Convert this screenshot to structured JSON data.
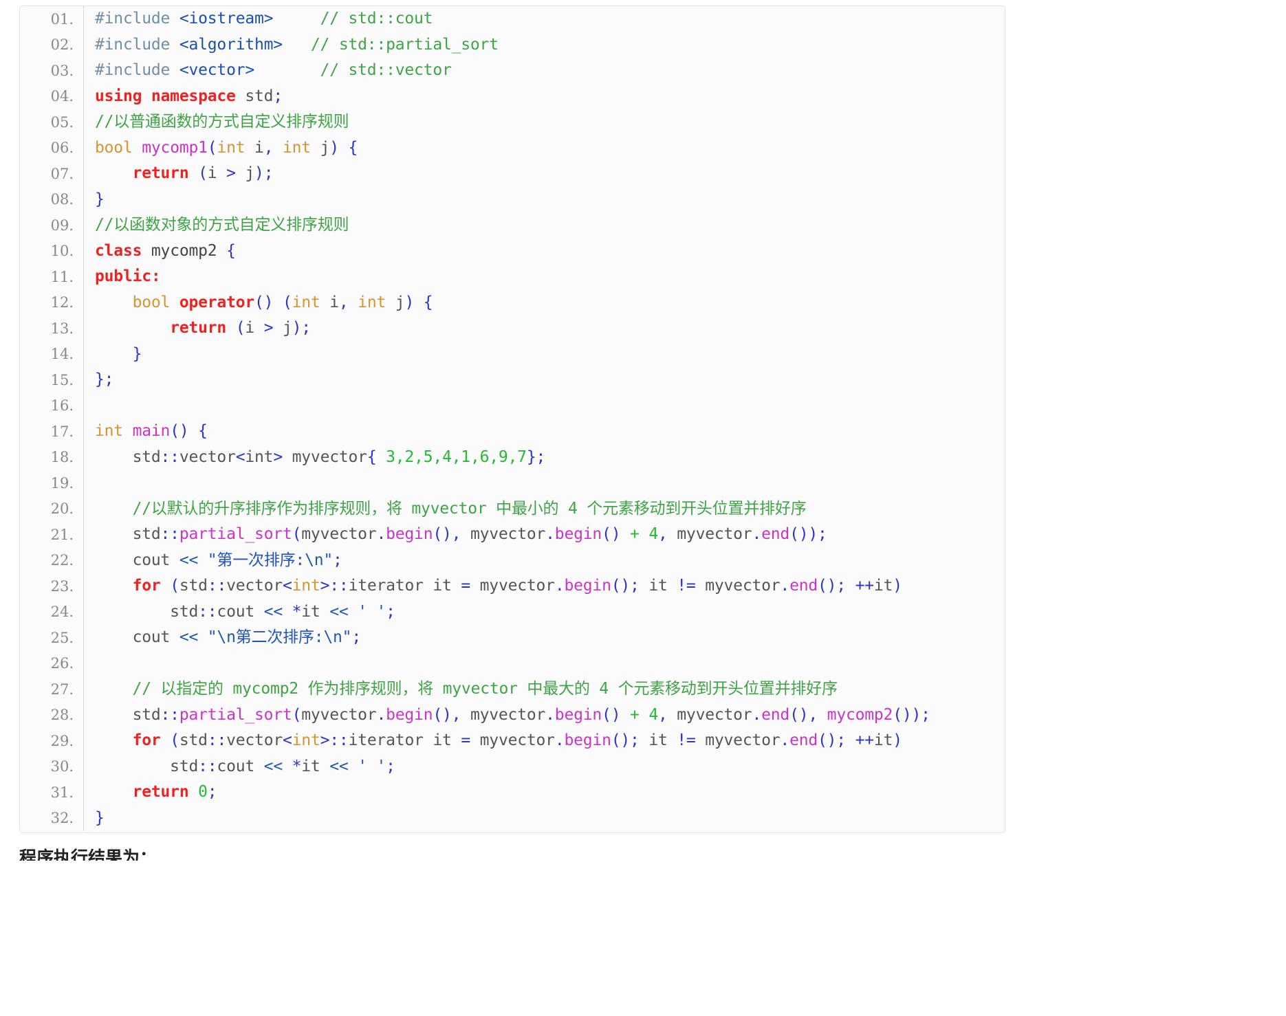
{
  "code_block": {
    "language": "cpp",
    "line_number_suffix": ".",
    "total_lines": 32,
    "colors": {
      "background": "#fbfbfb",
      "border": "#e3e3e3",
      "gutter_text": "#888888",
      "comment": "#3ea445",
      "keyword": "#ee2222",
      "type": "#d69532",
      "function": "#cc33cc",
      "punctuation": "#2b33cc",
      "number": "#22bb33",
      "string": "#2255bb",
      "preprocessor": "#6f8ea8",
      "header_name": "#1a4fb4",
      "plain": "#555555"
    },
    "lines": [
      {
        "num": "01.",
        "tokens": [
          {
            "t": "#include ",
            "c": "t-pre"
          },
          {
            "t": "<iostream>",
            "c": "t-header"
          },
          {
            "t": "     ",
            "c": "t-plain"
          },
          {
            "t": "// std::cout",
            "c": "t-comment"
          }
        ]
      },
      {
        "num": "02.",
        "tokens": [
          {
            "t": "#include ",
            "c": "t-pre"
          },
          {
            "t": "<algorithm>",
            "c": "t-header"
          },
          {
            "t": "   ",
            "c": "t-plain"
          },
          {
            "t": "// std::partial_sort",
            "c": "t-comment"
          }
        ]
      },
      {
        "num": "03.",
        "tokens": [
          {
            "t": "#include ",
            "c": "t-pre"
          },
          {
            "t": "<vector>",
            "c": "t-header"
          },
          {
            "t": "       ",
            "c": "t-plain"
          },
          {
            "t": "// std::vector",
            "c": "t-comment"
          }
        ]
      },
      {
        "num": "04.",
        "tokens": [
          {
            "t": "using namespace",
            "c": "t-kw"
          },
          {
            "t": " std",
            "c": "t-plain"
          },
          {
            "t": ";",
            "c": "t-punc"
          }
        ]
      },
      {
        "num": "05.",
        "tokens": [
          {
            "t": "//以普通函数的方式自定义排序规则",
            "c": "t-comment"
          }
        ]
      },
      {
        "num": "06.",
        "tokens": [
          {
            "t": "bool",
            "c": "t-type"
          },
          {
            "t": " ",
            "c": "t-plain"
          },
          {
            "t": "mycomp1",
            "c": "t-fn"
          },
          {
            "t": "(",
            "c": "t-punc"
          },
          {
            "t": "int",
            "c": "t-type"
          },
          {
            "t": " i",
            "c": "t-plain"
          },
          {
            "t": ",",
            "c": "t-punc"
          },
          {
            "t": " ",
            "c": "t-plain"
          },
          {
            "t": "int",
            "c": "t-type"
          },
          {
            "t": " j",
            "c": "t-plain"
          },
          {
            "t": ") {",
            "c": "t-punc"
          }
        ]
      },
      {
        "num": "07.",
        "tokens": [
          {
            "t": "    ",
            "c": "t-plain"
          },
          {
            "t": "return",
            "c": "t-kw"
          },
          {
            "t": " ",
            "c": "t-plain"
          },
          {
            "t": "(",
            "c": "t-punc"
          },
          {
            "t": "i ",
            "c": "t-plain"
          },
          {
            "t": ">",
            "c": "t-punc"
          },
          {
            "t": " j",
            "c": "t-plain"
          },
          {
            "t": ");",
            "c": "t-punc"
          }
        ]
      },
      {
        "num": "08.",
        "tokens": [
          {
            "t": "}",
            "c": "t-punc"
          }
        ]
      },
      {
        "num": "09.",
        "tokens": [
          {
            "t": "//以函数对象的方式自定义排序规则",
            "c": "t-comment"
          }
        ]
      },
      {
        "num": "10.",
        "tokens": [
          {
            "t": "class",
            "c": "t-kw"
          },
          {
            "t": " mycomp2 ",
            "c": "t-ident"
          },
          {
            "t": "{",
            "c": "t-punc"
          }
        ]
      },
      {
        "num": "11.",
        "tokens": [
          {
            "t": "public:",
            "c": "t-kw"
          }
        ]
      },
      {
        "num": "12.",
        "tokens": [
          {
            "t": "    ",
            "c": "t-plain"
          },
          {
            "t": "bool",
            "c": "t-type"
          },
          {
            "t": " ",
            "c": "t-plain"
          },
          {
            "t": "operator",
            "c": "t-kw"
          },
          {
            "t": "() (",
            "c": "t-punc"
          },
          {
            "t": "int",
            "c": "t-type"
          },
          {
            "t": " i",
            "c": "t-plain"
          },
          {
            "t": ",",
            "c": "t-punc"
          },
          {
            "t": " ",
            "c": "t-plain"
          },
          {
            "t": "int",
            "c": "t-type"
          },
          {
            "t": " j",
            "c": "t-plain"
          },
          {
            "t": ") {",
            "c": "t-punc"
          }
        ]
      },
      {
        "num": "13.",
        "tokens": [
          {
            "t": "        ",
            "c": "t-plain"
          },
          {
            "t": "return",
            "c": "t-kw"
          },
          {
            "t": " ",
            "c": "t-plain"
          },
          {
            "t": "(",
            "c": "t-punc"
          },
          {
            "t": "i ",
            "c": "t-plain"
          },
          {
            "t": ">",
            "c": "t-punc"
          },
          {
            "t": " j",
            "c": "t-plain"
          },
          {
            "t": ");",
            "c": "t-punc"
          }
        ]
      },
      {
        "num": "14.",
        "tokens": [
          {
            "t": "    ",
            "c": "t-plain"
          },
          {
            "t": "}",
            "c": "t-punc"
          }
        ]
      },
      {
        "num": "15.",
        "tokens": [
          {
            "t": "};",
            "c": "t-punc"
          }
        ]
      },
      {
        "num": "16.",
        "tokens": []
      },
      {
        "num": "17.",
        "tokens": [
          {
            "t": "int",
            "c": "t-type"
          },
          {
            "t": " ",
            "c": "t-plain"
          },
          {
            "t": "main",
            "c": "t-fn"
          },
          {
            "t": "() {",
            "c": "t-punc"
          }
        ]
      },
      {
        "num": "18.",
        "tokens": [
          {
            "t": "    std",
            "c": "t-plain"
          },
          {
            "t": "::",
            "c": "t-punc"
          },
          {
            "t": "vector",
            "c": "t-plain"
          },
          {
            "t": "<",
            "c": "t-punc"
          },
          {
            "t": "int",
            "c": "t-plain"
          },
          {
            "t": ">",
            "c": "t-punc"
          },
          {
            "t": " myvector",
            "c": "t-plain"
          },
          {
            "t": "{",
            "c": "t-punc"
          },
          {
            "t": " ",
            "c": "t-plain"
          },
          {
            "t": "3,2,5,4,1,6,9,7",
            "c": "t-num"
          },
          {
            "t": "};",
            "c": "t-punc"
          }
        ]
      },
      {
        "num": "19.",
        "tokens": []
      },
      {
        "num": "20.",
        "tokens": [
          {
            "t": "    //以默认的升序排序作为排序规则，将 myvector 中最小的 4 个元素移动到开头位置并排好序",
            "c": "t-comment"
          }
        ]
      },
      {
        "num": "21.",
        "tokens": [
          {
            "t": "    std",
            "c": "t-plain"
          },
          {
            "t": "::",
            "c": "t-punc"
          },
          {
            "t": "partial_sort",
            "c": "t-fn"
          },
          {
            "t": "(",
            "c": "t-punc"
          },
          {
            "t": "myvector",
            "c": "t-plain"
          },
          {
            "t": ".",
            "c": "t-punc"
          },
          {
            "t": "begin",
            "c": "t-fn"
          },
          {
            "t": "(),",
            "c": "t-punc"
          },
          {
            "t": " myvector",
            "c": "t-plain"
          },
          {
            "t": ".",
            "c": "t-punc"
          },
          {
            "t": "begin",
            "c": "t-fn"
          },
          {
            "t": "()",
            "c": "t-punc"
          },
          {
            "t": " ",
            "c": "t-plain"
          },
          {
            "t": "+",
            "c": "t-num"
          },
          {
            "t": " ",
            "c": "t-plain"
          },
          {
            "t": "4",
            "c": "t-num"
          },
          {
            "t": ",",
            "c": "t-punc"
          },
          {
            "t": " myvector",
            "c": "t-plain"
          },
          {
            "t": ".",
            "c": "t-punc"
          },
          {
            "t": "end",
            "c": "t-fn"
          },
          {
            "t": "());",
            "c": "t-punc"
          }
        ]
      },
      {
        "num": "22.",
        "tokens": [
          {
            "t": "    cout ",
            "c": "t-plain"
          },
          {
            "t": "<<",
            "c": "t-str"
          },
          {
            "t": " ",
            "c": "t-plain"
          },
          {
            "t": "\"第一次排序:\\n\"",
            "c": "t-str"
          },
          {
            "t": ";",
            "c": "t-punc"
          }
        ]
      },
      {
        "num": "23.",
        "tokens": [
          {
            "t": "    ",
            "c": "t-plain"
          },
          {
            "t": "for",
            "c": "t-kw"
          },
          {
            "t": " ",
            "c": "t-plain"
          },
          {
            "t": "(",
            "c": "t-punc"
          },
          {
            "t": "std",
            "c": "t-plain"
          },
          {
            "t": "::",
            "c": "t-punc"
          },
          {
            "t": "vector",
            "c": "t-plain"
          },
          {
            "t": "<",
            "c": "t-punc"
          },
          {
            "t": "int",
            "c": "t-type"
          },
          {
            "t": ">",
            "c": "t-punc"
          },
          {
            "t": "::",
            "c": "t-punc"
          },
          {
            "t": "iterator it ",
            "c": "t-plain"
          },
          {
            "t": "=",
            "c": "t-punc"
          },
          {
            "t": " myvector",
            "c": "t-plain"
          },
          {
            "t": ".",
            "c": "t-punc"
          },
          {
            "t": "begin",
            "c": "t-fn"
          },
          {
            "t": "();",
            "c": "t-punc"
          },
          {
            "t": " it ",
            "c": "t-plain"
          },
          {
            "t": "!=",
            "c": "t-punc"
          },
          {
            "t": " myvector",
            "c": "t-plain"
          },
          {
            "t": ".",
            "c": "t-punc"
          },
          {
            "t": "end",
            "c": "t-fn"
          },
          {
            "t": "();",
            "c": "t-punc"
          },
          {
            "t": " ",
            "c": "t-plain"
          },
          {
            "t": "++",
            "c": "t-punc"
          },
          {
            "t": "it",
            "c": "t-plain"
          },
          {
            "t": ")",
            "c": "t-punc"
          }
        ]
      },
      {
        "num": "24.",
        "tokens": [
          {
            "t": "        std",
            "c": "t-plain"
          },
          {
            "t": "::",
            "c": "t-punc"
          },
          {
            "t": "cout ",
            "c": "t-plain"
          },
          {
            "t": "<<",
            "c": "t-str"
          },
          {
            "t": " ",
            "c": "t-plain"
          },
          {
            "t": "*",
            "c": "t-punc"
          },
          {
            "t": "it ",
            "c": "t-plain"
          },
          {
            "t": "<<",
            "c": "t-str"
          },
          {
            "t": " ",
            "c": "t-plain"
          },
          {
            "t": "' '",
            "c": "t-str"
          },
          {
            "t": ";",
            "c": "t-punc"
          }
        ]
      },
      {
        "num": "25.",
        "tokens": [
          {
            "t": "    cout ",
            "c": "t-plain"
          },
          {
            "t": "<<",
            "c": "t-str"
          },
          {
            "t": " ",
            "c": "t-plain"
          },
          {
            "t": "\"\\n第二次排序:\\n\"",
            "c": "t-str"
          },
          {
            "t": ";",
            "c": "t-punc"
          }
        ]
      },
      {
        "num": "26.",
        "tokens": []
      },
      {
        "num": "27.",
        "tokens": [
          {
            "t": "    // 以指定的 mycomp2 作为排序规则，将 myvector 中最大的 4 个元素移动到开头位置并排好序",
            "c": "t-comment"
          }
        ]
      },
      {
        "num": "28.",
        "tokens": [
          {
            "t": "    std",
            "c": "t-plain"
          },
          {
            "t": "::",
            "c": "t-punc"
          },
          {
            "t": "partial_sort",
            "c": "t-fn"
          },
          {
            "t": "(",
            "c": "t-punc"
          },
          {
            "t": "myvector",
            "c": "t-plain"
          },
          {
            "t": ".",
            "c": "t-punc"
          },
          {
            "t": "begin",
            "c": "t-fn"
          },
          {
            "t": "(),",
            "c": "t-punc"
          },
          {
            "t": " myvector",
            "c": "t-plain"
          },
          {
            "t": ".",
            "c": "t-punc"
          },
          {
            "t": "begin",
            "c": "t-fn"
          },
          {
            "t": "()",
            "c": "t-punc"
          },
          {
            "t": " ",
            "c": "t-plain"
          },
          {
            "t": "+",
            "c": "t-num"
          },
          {
            "t": " ",
            "c": "t-plain"
          },
          {
            "t": "4",
            "c": "t-num"
          },
          {
            "t": ",",
            "c": "t-punc"
          },
          {
            "t": " myvector",
            "c": "t-plain"
          },
          {
            "t": ".",
            "c": "t-punc"
          },
          {
            "t": "end",
            "c": "t-fn"
          },
          {
            "t": "(),",
            "c": "t-punc"
          },
          {
            "t": " ",
            "c": "t-plain"
          },
          {
            "t": "mycomp2",
            "c": "t-fn"
          },
          {
            "t": "());",
            "c": "t-punc"
          }
        ]
      },
      {
        "num": "29.",
        "tokens": [
          {
            "t": "    ",
            "c": "t-plain"
          },
          {
            "t": "for",
            "c": "t-kw"
          },
          {
            "t": " ",
            "c": "t-plain"
          },
          {
            "t": "(",
            "c": "t-punc"
          },
          {
            "t": "std",
            "c": "t-plain"
          },
          {
            "t": "::",
            "c": "t-punc"
          },
          {
            "t": "vector",
            "c": "t-plain"
          },
          {
            "t": "<",
            "c": "t-punc"
          },
          {
            "t": "int",
            "c": "t-type"
          },
          {
            "t": ">",
            "c": "t-punc"
          },
          {
            "t": "::",
            "c": "t-punc"
          },
          {
            "t": "iterator it ",
            "c": "t-plain"
          },
          {
            "t": "=",
            "c": "t-punc"
          },
          {
            "t": " myvector",
            "c": "t-plain"
          },
          {
            "t": ".",
            "c": "t-punc"
          },
          {
            "t": "begin",
            "c": "t-fn"
          },
          {
            "t": "();",
            "c": "t-punc"
          },
          {
            "t": " it ",
            "c": "t-plain"
          },
          {
            "t": "!=",
            "c": "t-punc"
          },
          {
            "t": " myvector",
            "c": "t-plain"
          },
          {
            "t": ".",
            "c": "t-punc"
          },
          {
            "t": "end",
            "c": "t-fn"
          },
          {
            "t": "();",
            "c": "t-punc"
          },
          {
            "t": " ",
            "c": "t-plain"
          },
          {
            "t": "++",
            "c": "t-punc"
          },
          {
            "t": "it",
            "c": "t-plain"
          },
          {
            "t": ")",
            "c": "t-punc"
          }
        ]
      },
      {
        "num": "30.",
        "tokens": [
          {
            "t": "        std",
            "c": "t-plain"
          },
          {
            "t": "::",
            "c": "t-punc"
          },
          {
            "t": "cout ",
            "c": "t-plain"
          },
          {
            "t": "<<",
            "c": "t-str"
          },
          {
            "t": " ",
            "c": "t-plain"
          },
          {
            "t": "*",
            "c": "t-punc"
          },
          {
            "t": "it ",
            "c": "t-plain"
          },
          {
            "t": "<<",
            "c": "t-str"
          },
          {
            "t": " ",
            "c": "t-plain"
          },
          {
            "t": "' '",
            "c": "t-str"
          },
          {
            "t": ";",
            "c": "t-punc"
          }
        ]
      },
      {
        "num": "31.",
        "tokens": [
          {
            "t": "    ",
            "c": "t-plain"
          },
          {
            "t": "return",
            "c": "t-kw"
          },
          {
            "t": " ",
            "c": "t-plain"
          },
          {
            "t": "0",
            "c": "t-num"
          },
          {
            "t": ";",
            "c": "t-punc"
          }
        ]
      },
      {
        "num": "32.",
        "tokens": [
          {
            "t": "}",
            "c": "t-punc"
          }
        ]
      }
    ]
  },
  "caption": {
    "text": "程序执行结果为："
  }
}
